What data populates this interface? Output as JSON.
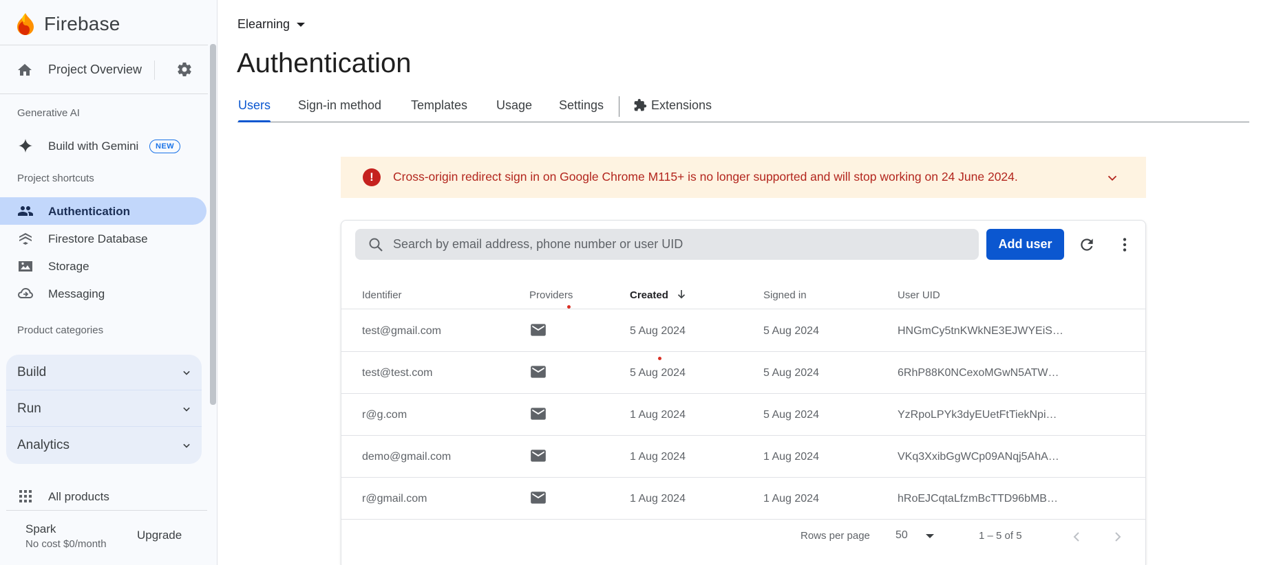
{
  "sidebar": {
    "brand": "Firebase",
    "project_overview": "Project Overview",
    "sections": {
      "generative_ai": "Generative AI",
      "project_shortcuts": "Project shortcuts",
      "product_categories": "Product categories"
    },
    "build_with_gemini": "Build with Gemini",
    "new_badge": "NEW",
    "shortcuts": [
      {
        "label": "Authentication",
        "icon": "people-icon",
        "active": true
      },
      {
        "label": "Firestore Database",
        "icon": "firestore-icon",
        "active": false
      },
      {
        "label": "Storage",
        "icon": "image-icon",
        "active": false
      },
      {
        "label": "Messaging",
        "icon": "cloud-messaging-icon",
        "active": false
      }
    ],
    "categories": [
      "Build",
      "Run",
      "Analytics"
    ],
    "all_products": "All products",
    "plan": {
      "name": "Spark",
      "price": "No cost $0/month",
      "upgrade": "Upgrade"
    }
  },
  "header": {
    "project": "Elearning",
    "title": "Authentication",
    "tabs": [
      "Users",
      "Sign-in method",
      "Templates",
      "Usage",
      "Settings",
      "Extensions"
    ],
    "active_tab": "Users"
  },
  "banner": {
    "message": "Cross-origin redirect sign in on Google Chrome M115+ is no longer supported and will stop working on 24 June 2024."
  },
  "users_table": {
    "search_placeholder": "Search by email address, phone number or user UID",
    "add_user": "Add user",
    "columns": [
      "Identifier",
      "Providers",
      "Created",
      "Signed in",
      "User UID"
    ],
    "sorted_column": "Created",
    "rows": [
      {
        "identifier": "test@gmail.com",
        "provider": "email",
        "created": "5 Aug 2024",
        "signed_in": "5 Aug 2024",
        "uid": "HNGmCy5tnKWkNE3EJWYEiS…"
      },
      {
        "identifier": "test@test.com",
        "provider": "email",
        "created": "5 Aug 2024",
        "signed_in": "5 Aug 2024",
        "uid": "6RhP88K0NCexoMGwN5ATW…"
      },
      {
        "identifier": "r@g.com",
        "provider": "email",
        "created": "1 Aug 2024",
        "signed_in": "5 Aug 2024",
        "uid": "YzRpoLPYk3dyEUetFtTiekNpi…"
      },
      {
        "identifier": "demo@gmail.com",
        "provider": "email",
        "created": "1 Aug 2024",
        "signed_in": "1 Aug 2024",
        "uid": "VKq3XxibGgWCp09ANqj5AhA…"
      },
      {
        "identifier": "r@gmail.com",
        "provider": "email",
        "created": "1 Aug 2024",
        "signed_in": "1 Aug 2024",
        "uid": "hRoEJCqtaLfzmBcTTD96bMB…"
      }
    ],
    "pagination": {
      "rows_per_page_label": "Rows per page",
      "rows_per_page": "50",
      "range": "1 – 5 of 5"
    }
  },
  "colors": {
    "accent": "#0b57d0",
    "active_nav": "#c2d7fb",
    "banner_bg": "#fef3e1",
    "banner_text": "#b3261e"
  }
}
